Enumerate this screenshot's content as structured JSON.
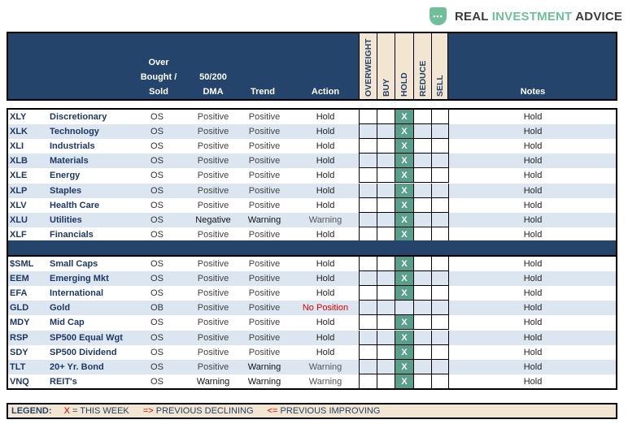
{
  "logo": {
    "icon": "chat-dots-shield-icon",
    "icon_glyph": "•••",
    "word1": "REAL",
    "word2": "INVESTMENT",
    "word3": "ADVICE"
  },
  "header": {
    "obs_line1": "Over",
    "obs_line2": "Bought /",
    "obs_line3": "Sold",
    "dma_line1": "50/200",
    "dma_line2": "DMA",
    "trend": "Trend",
    "action": "Action",
    "cols": [
      "OVERWEIGHT",
      "BUY",
      "HOLD",
      "REDUCE",
      "SELL"
    ],
    "notes": "Notes"
  },
  "sectors": [
    {
      "ticker": "XLY",
      "name": "Discretionary",
      "obs": "OS",
      "dma": "Positive",
      "trend": "Positive",
      "action": "Hold",
      "position": "HOLD",
      "notes": "Hold"
    },
    {
      "ticker": "XLK",
      "name": "Technology",
      "obs": "OS",
      "dma": "Positive",
      "trend": "Positive",
      "action": "Hold",
      "position": "HOLD",
      "notes": "Hold"
    },
    {
      "ticker": "XLI",
      "name": "Industrials",
      "obs": "OS",
      "dma": "Positive",
      "trend": "Positive",
      "action": "Hold",
      "position": "HOLD",
      "notes": "Hold"
    },
    {
      "ticker": "XLB",
      "name": "Materials",
      "obs": "OS",
      "dma": "Positive",
      "trend": "Positive",
      "action": "Hold",
      "position": "HOLD",
      "notes": "Hold"
    },
    {
      "ticker": "XLE",
      "name": "Energy",
      "obs": "OS",
      "dma": "Positive",
      "trend": "Positive",
      "action": "Hold",
      "position": "HOLD",
      "notes": "Hold"
    },
    {
      "ticker": "XLP",
      "name": "Staples",
      "obs": "OS",
      "dma": "Positive",
      "trend": "Positive",
      "action": "Hold",
      "position": "HOLD",
      "notes": "Hold"
    },
    {
      "ticker": "XLV",
      "name": "Health Care",
      "obs": "OS",
      "dma": "Positive",
      "trend": "Positive",
      "action": "Hold",
      "position": "HOLD",
      "notes": "Hold"
    },
    {
      "ticker": "XLU",
      "name": "Utilities",
      "obs": "OS",
      "dma": "Negative",
      "trend": "Warning",
      "action": "Warning",
      "position": "HOLD",
      "notes": "Hold"
    },
    {
      "ticker": "XLF",
      "name": "Financials",
      "obs": "OS",
      "dma": "Positive",
      "trend": "Positive",
      "action": "Hold",
      "position": "HOLD",
      "notes": "Hold"
    }
  ],
  "markets": [
    {
      "ticker": "$SML",
      "name": "Small Caps",
      "obs": "OS",
      "dma": "Positive",
      "trend": "Positive",
      "action": "Hold",
      "position": "HOLD",
      "notes": "Hold"
    },
    {
      "ticker": "EEM",
      "name": "Emerging Mkt",
      "obs": "OS",
      "dma": "Positive",
      "trend": "Positive",
      "action": "Hold",
      "position": "HOLD",
      "notes": "Hold"
    },
    {
      "ticker": "EFA",
      "name": "International",
      "obs": "OS",
      "dma": "Positive",
      "trend": "Positive",
      "action": "Hold",
      "position": "HOLD",
      "notes": "Hold"
    },
    {
      "ticker": "GLD",
      "name": "Gold",
      "obs": "OB",
      "dma": "Positive",
      "trend": "Positive",
      "action": "No Position",
      "position": "",
      "notes": "Hold"
    },
    {
      "ticker": "MDY",
      "name": "Mid Cap",
      "obs": "OS",
      "dma": "Positive",
      "trend": "Positive",
      "action": "Hold",
      "position": "HOLD",
      "notes": "Hold"
    },
    {
      "ticker": "RSP",
      "name": "SP500 Equal Wgt",
      "obs": "OS",
      "dma": "Positive",
      "trend": "Positive",
      "action": "Hold",
      "position": "HOLD",
      "notes": "Hold"
    },
    {
      "ticker": "SDY",
      "name": "SP500 Dividend",
      "obs": "OS",
      "dma": "Positive",
      "trend": "Positive",
      "action": "Hold",
      "position": "HOLD",
      "notes": "Hold"
    },
    {
      "ticker": "TLT",
      "name": "20+ Yr. Bond",
      "obs": "OS",
      "dma": "Positive",
      "trend": "Warning",
      "action": "Warning",
      "position": "HOLD",
      "notes": "Hold"
    },
    {
      "ticker": "VNQ",
      "name": "REIT's",
      "obs": "OS",
      "dma": "Warning",
      "trend": "Warning",
      "action": "Warning",
      "position": "HOLD",
      "notes": "Hold"
    }
  ],
  "mark": "X",
  "legend": {
    "label": "LEGEND:",
    "x_symbol": "X",
    "x_text": "= THIS WEEK",
    "declining_symbol": "=>",
    "declining_text": "PREVIOUS DECLINING",
    "improving_symbol": "<=",
    "improving_text": "PREVIOUS IMPROVING"
  },
  "colors": {
    "navy": "#24446b",
    "cream": "#f2e6d2",
    "hold_green": "#5a9e8c",
    "alt_row": "#dce6f1",
    "alert_red": "#e00000",
    "brand_green": "#6fbf9a"
  }
}
